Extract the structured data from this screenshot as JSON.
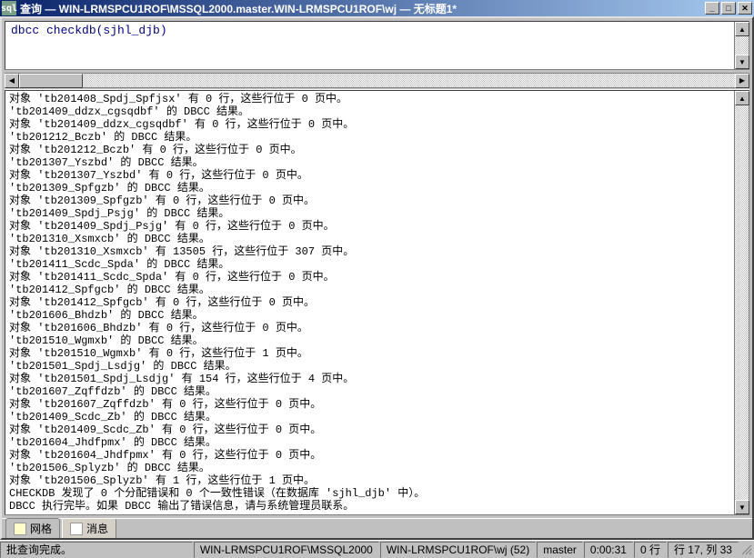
{
  "titlebar": {
    "title": "查询  —  WIN-LRMSPCU1ROF\\MSSQL2000.master.WIN-LRMSPCU1ROF\\wj  —  无标题1*",
    "icon_label": "sql"
  },
  "query": {
    "text": "dbcc checkdb(sjhl_djb)"
  },
  "results": {
    "lines": [
      "对象 'tb201408_Spdj_Spfjsx' 有 0 行，这些行位于 0 页中。",
      "'tb201409_ddzx_cgsqdbf' 的 DBCC 结果。",
      "对象 'tb201409_ddzx_cgsqdbf' 有 0 行，这些行位于 0 页中。",
      "'tb201212_Bczb' 的 DBCC 结果。",
      "对象 'tb201212_Bczb' 有 0 行，这些行位于 0 页中。",
      "'tb201307_Yszbd' 的 DBCC 结果。",
      "对象 'tb201307_Yszbd' 有 0 行，这些行位于 0 页中。",
      "'tb201309_Spfgzb' 的 DBCC 结果。",
      "对象 'tb201309_Spfgzb' 有 0 行，这些行位于 0 页中。",
      "'tb201409_Spdj_Psjg' 的 DBCC 结果。",
      "对象 'tb201409_Spdj_Psjg' 有 0 行，这些行位于 0 页中。",
      "'tb201310_Xsmxcb' 的 DBCC 结果。",
      "对象 'tb201310_Xsmxcb' 有 13505 行，这些行位于 307 页中。",
      "'tb201411_Scdc_Spda' 的 DBCC 结果。",
      "对象 'tb201411_Scdc_Spda' 有 0 行，这些行位于 0 页中。",
      "'tb201412_Spfgcb' 的 DBCC 结果。",
      "对象 'tb201412_Spfgcb' 有 0 行，这些行位于 0 页中。",
      "'tb201606_Bhdzb' 的 DBCC 结果。",
      "对象 'tb201606_Bhdzb' 有 0 行，这些行位于 0 页中。",
      "'tb201510_Wgmxb' 的 DBCC 结果。",
      "对象 'tb201510_Wgmxb' 有 0 行，这些行位于 1 页中。",
      "'tb201501_Spdj_Lsdjg' 的 DBCC 结果。",
      "对象 'tb201501_Spdj_Lsdjg' 有 154 行，这些行位于 4 页中。",
      "'tb201607_Zqffdzb' 的 DBCC 结果。",
      "对象 'tb201607_Zqffdzb' 有 0 行，这些行位于 0 页中。",
      "'tb201409_Scdc_Zb' 的 DBCC 结果。",
      "对象 'tb201409_Scdc_Zb' 有 0 行，这些行位于 0 页中。",
      "'tb201604_Jhdfpmx' 的 DBCC 结果。",
      "对象 'tb201604_Jhdfpmx' 有 0 行，这些行位于 0 页中。",
      "'tb201506_Splyzb' 的 DBCC 结果。",
      "对象 'tb201506_Splyzb' 有 1 行，这些行位于 1 页中。",
      "CHECKDB 发现了 0 个分配错误和 0 个一致性错误（在数据库 'sjhl_djb' 中）。",
      "DBCC 执行完毕。如果 DBCC 输出了错误信息，请与系统管理员联系。"
    ]
  },
  "tabs": {
    "grid": "网格",
    "messages": "消息"
  },
  "status": {
    "msg": "批查询完成。",
    "server": "WIN-LRMSPCU1ROF\\MSSQL2000",
    "user": "WIN-LRMSPCU1ROF\\wj (52)",
    "db": "master",
    "time": "0:00:31",
    "rows": "0 行",
    "pos": "行 17, 列 33"
  },
  "winbtns": {
    "min": "_",
    "max": "□",
    "close": "✕"
  },
  "arrows": {
    "up": "▲",
    "down": "▼",
    "left": "◀",
    "right": "▶"
  }
}
